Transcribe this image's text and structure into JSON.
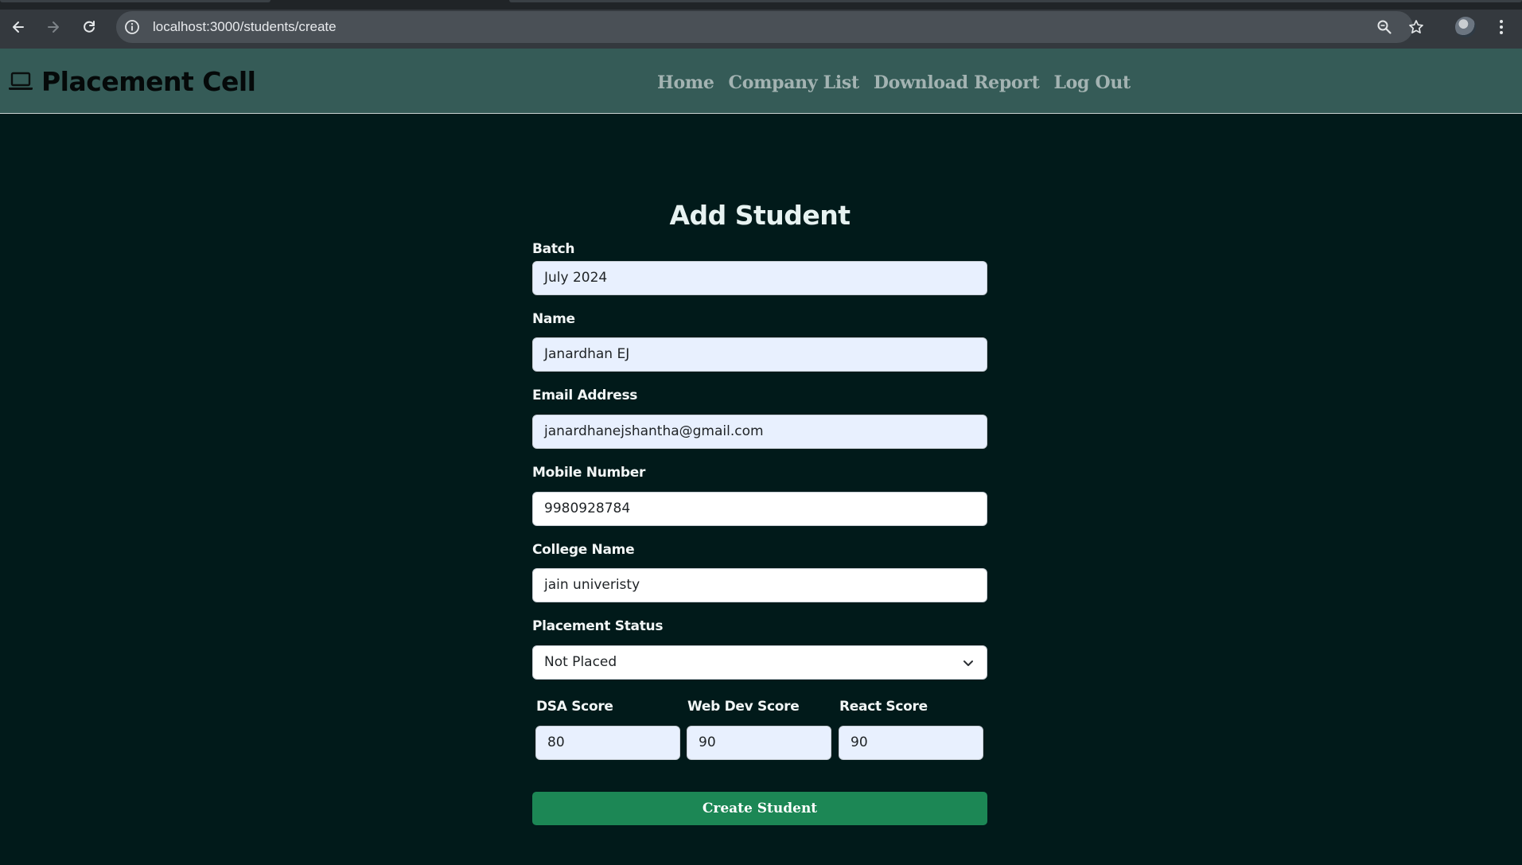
{
  "browser": {
    "url": "localhost:3000/students/create",
    "icons": [
      "back-icon",
      "forward-icon",
      "reload-icon",
      "site-info-icon",
      "zoom-icon",
      "bookmark-star-icon",
      "profile-avatar",
      "menu-kebab-icon"
    ]
  },
  "header": {
    "brand": "Placement Cell",
    "brand_icon": "laptop-icon",
    "nav": [
      "Home",
      "Company List",
      "Download Report",
      "Log Out"
    ]
  },
  "form": {
    "title": "Add Student",
    "batch": {
      "label": "Batch",
      "value": "July 2024"
    },
    "name": {
      "label": "Name",
      "value": "Janardhan EJ"
    },
    "email": {
      "label": "Email Address",
      "value": "janardhanejshantha@gmail.com"
    },
    "mobile": {
      "label": "Mobile Number",
      "value": "9980928784"
    },
    "college": {
      "label": "College Name",
      "value": "jain univeristy"
    },
    "status": {
      "label": "Placement Status",
      "value": "Not Placed"
    },
    "scores": [
      {
        "label": "DSA Score",
        "value": "80"
      },
      {
        "label": "Web Dev Score",
        "value": "90"
      },
      {
        "label": "React Score",
        "value": "90"
      }
    ],
    "submit_label": "Create Student"
  },
  "colors": {
    "page_bg": "#011a1a",
    "header_bg": "#355b57",
    "nav_link": "#a3b3b2",
    "submit_bg": "#1c8755",
    "autofill_bg": "#e8f0fe"
  }
}
